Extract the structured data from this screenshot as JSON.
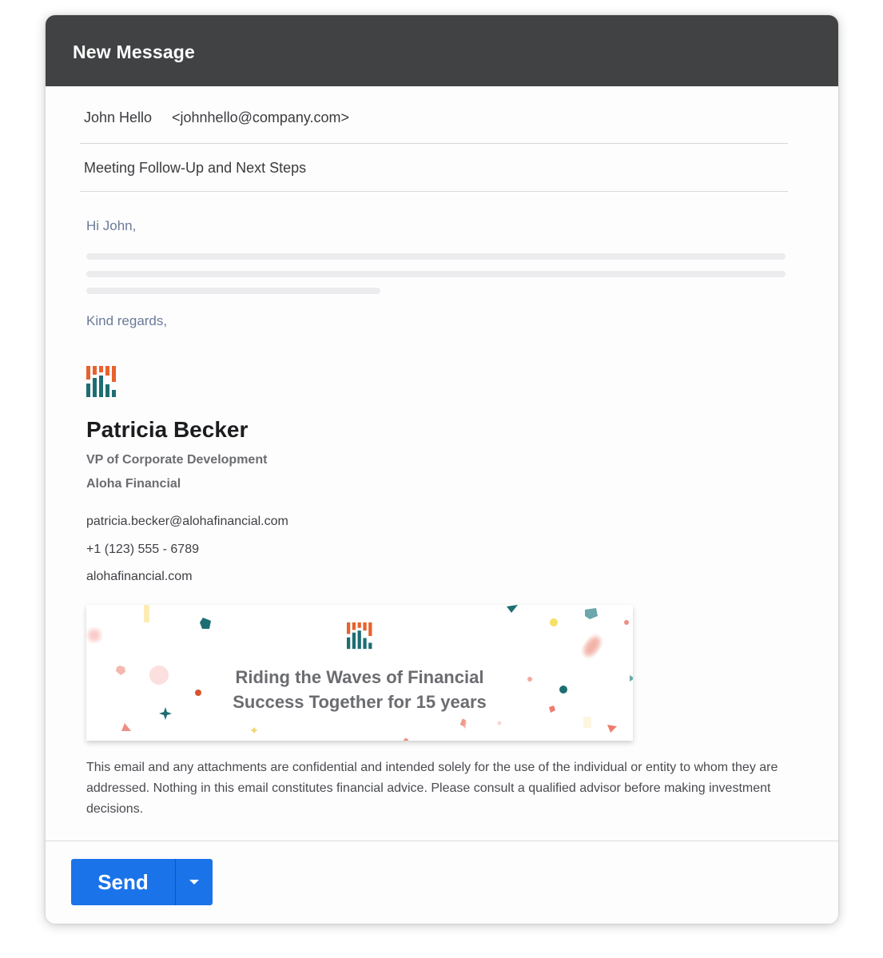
{
  "window": {
    "title": "New Message"
  },
  "compose": {
    "to_name": "John Hello",
    "to_email": "<johnhello@company.com>",
    "subject": "Meeting Follow-Up and Next Steps"
  },
  "body": {
    "greeting": "Hi John,",
    "closing": "Kind regards,"
  },
  "signature": {
    "logo_icon": "aloha-financial-logo",
    "name": "Patricia Becker",
    "role": "VP of Corporate Development",
    "company": "Aloha Financial",
    "email": "patricia.becker@alohafinancial.com",
    "phone": "+1 (123) 555 - 6789",
    "website": "alohafinancial.com",
    "banner_line1": "Riding the Waves of Financial",
    "banner_line2": "Success Together for 15 years",
    "disclaimer": "This email and any attachments are confidential and intended solely for the use of the individual or entity to whom they are addressed. Nothing in this email constitutes financial advice. Please consult a qualified advisor before making investment decisions."
  },
  "footer": {
    "send_label": "Send",
    "send_options_icon": "caret-down-icon"
  },
  "colors": {
    "titlebar": "#414244",
    "send_button": "#1a73e8",
    "logo_orange": "#e8622e",
    "logo_teal": "#1d6e73"
  }
}
